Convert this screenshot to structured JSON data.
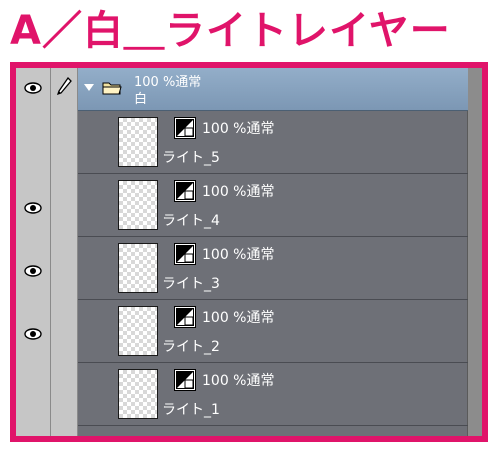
{
  "heading": {
    "text": "A／白＿ライトレイヤー",
    "color": "#e0146a"
  },
  "folder": {
    "mode": "100 %通常",
    "name": "白",
    "expanded": true,
    "icons": [
      "eye-icon",
      "pen-icon",
      "disclosure-arrow-icon",
      "folder-icon"
    ]
  },
  "layers": [
    {
      "name": "ライト_5",
      "mode": "100 %通常",
      "visible": false
    },
    {
      "name": "ライト_4",
      "mode": "100 %通常",
      "visible": true
    },
    {
      "name": "ライト_3",
      "mode": "100 %通常",
      "visible": true
    },
    {
      "name": "ライト_2",
      "mode": "100 %通常",
      "visible": true
    },
    {
      "name": "ライト_1",
      "mode": "100 %通常",
      "visible": false
    }
  ],
  "colors": {
    "frame": "#e0146a",
    "panel": "#6e7077",
    "folder_row": "#8aa5c1"
  }
}
